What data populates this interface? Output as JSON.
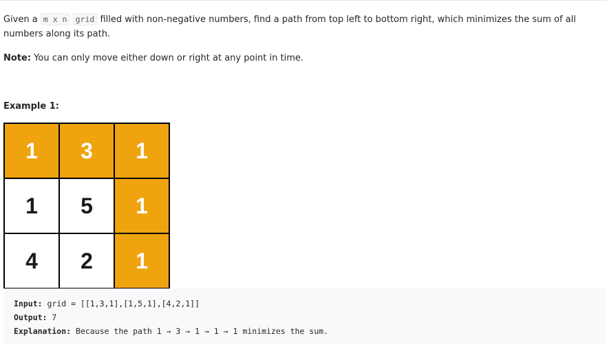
{
  "intro": {
    "before": "Given a ",
    "code_dims": "m x n",
    "between": " ",
    "code_grid": "grid",
    "after": " filled with non-negative numbers, find a path from top left to bottom right, which minimizes the sum of all numbers along its path."
  },
  "note": {
    "label": "Note:",
    "text": " You can only move either down or right at any point in time."
  },
  "example": {
    "title": "Example 1:",
    "grid": [
      [
        {
          "v": "1",
          "path": true
        },
        {
          "v": "3",
          "path": true
        },
        {
          "v": "1",
          "path": true
        }
      ],
      [
        {
          "v": "1",
          "path": false
        },
        {
          "v": "5",
          "path": false
        },
        {
          "v": "1",
          "path": true
        }
      ],
      [
        {
          "v": "4",
          "path": false
        },
        {
          "v": "2",
          "path": false
        },
        {
          "v": "1",
          "path": true
        }
      ]
    ],
    "input_label": "Input:",
    "input_value": " grid = [[1,3,1],[1,5,1],[4,2,1]]",
    "output_label": "Output:",
    "output_value": " 7",
    "explanation_label": "Explanation:",
    "explanation_value": " Because the path 1 → 3 → 1 → 1 → 1 minimizes the sum."
  },
  "colors": {
    "path_cell": "#efa30e",
    "grid_border": "#000000"
  }
}
